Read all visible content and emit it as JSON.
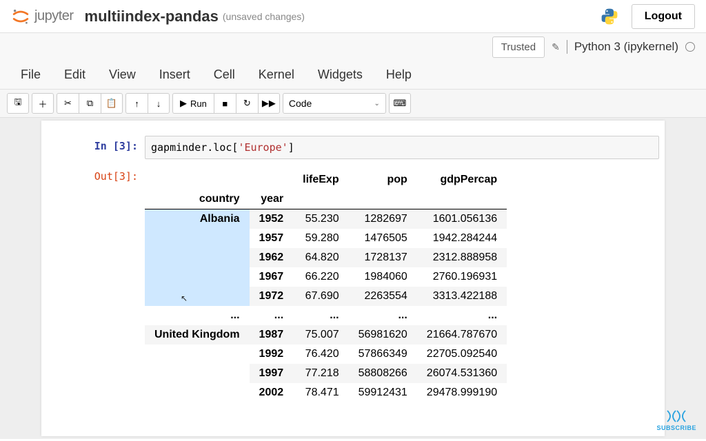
{
  "header": {
    "brand": "jupyter",
    "notebook_name": "multiindex-pandas",
    "unsaved": "(unsaved changes)",
    "logout": "Logout"
  },
  "status": {
    "trusted": "Trusted",
    "kernel": "Python 3 (ipykernel)"
  },
  "menu": [
    "File",
    "Edit",
    "View",
    "Insert",
    "Cell",
    "Kernel",
    "Widgets",
    "Help"
  ],
  "toolbar": {
    "run": "Run",
    "cell_type": "Code"
  },
  "cell": {
    "in_prompt": "In [3]:",
    "out_prompt": "Out[3]:",
    "code_prefix": "gapminder.loc[",
    "code_str": "'Europe'",
    "code_suffix": "]"
  },
  "table": {
    "index_names": [
      "country",
      "year"
    ],
    "columns": [
      "lifeExp",
      "pop",
      "gdpPercap"
    ],
    "rows": [
      {
        "country": "Albania",
        "year": "1952",
        "lifeExp": "55.230",
        "pop": "1282697",
        "gdpPercap": "1601.056136",
        "hl": true
      },
      {
        "country": "",
        "year": "1957",
        "lifeExp": "59.280",
        "pop": "1476505",
        "gdpPercap": "1942.284244",
        "hl": true
      },
      {
        "country": "",
        "year": "1962",
        "lifeExp": "64.820",
        "pop": "1728137",
        "gdpPercap": "2312.888958",
        "hl": true
      },
      {
        "country": "",
        "year": "1967",
        "lifeExp": "66.220",
        "pop": "1984060",
        "gdpPercap": "2760.196931",
        "hl": true
      },
      {
        "country": "",
        "year": "1972",
        "lifeExp": "67.690",
        "pop": "2263554",
        "gdpPercap": "3313.422188",
        "hl": true
      },
      {
        "country": "...",
        "year": "...",
        "lifeExp": "...",
        "pop": "...",
        "gdpPercap": "...",
        "hl": false,
        "ellipsis": true
      },
      {
        "country": "United Kingdom",
        "year": "1987",
        "lifeExp": "75.007",
        "pop": "56981620",
        "gdpPercap": "21664.787670",
        "hl": false
      },
      {
        "country": "",
        "year": "1992",
        "lifeExp": "76.420",
        "pop": "57866349",
        "gdpPercap": "22705.092540",
        "hl": false
      },
      {
        "country": "",
        "year": "1997",
        "lifeExp": "77.218",
        "pop": "58808266",
        "gdpPercap": "26074.531360",
        "hl": false
      },
      {
        "country": "",
        "year": "2002",
        "lifeExp": "78.471",
        "pop": "59912431",
        "gdpPercap": "29478.999190",
        "hl": false
      }
    ]
  },
  "subscribe": "SUBSCRIBE"
}
